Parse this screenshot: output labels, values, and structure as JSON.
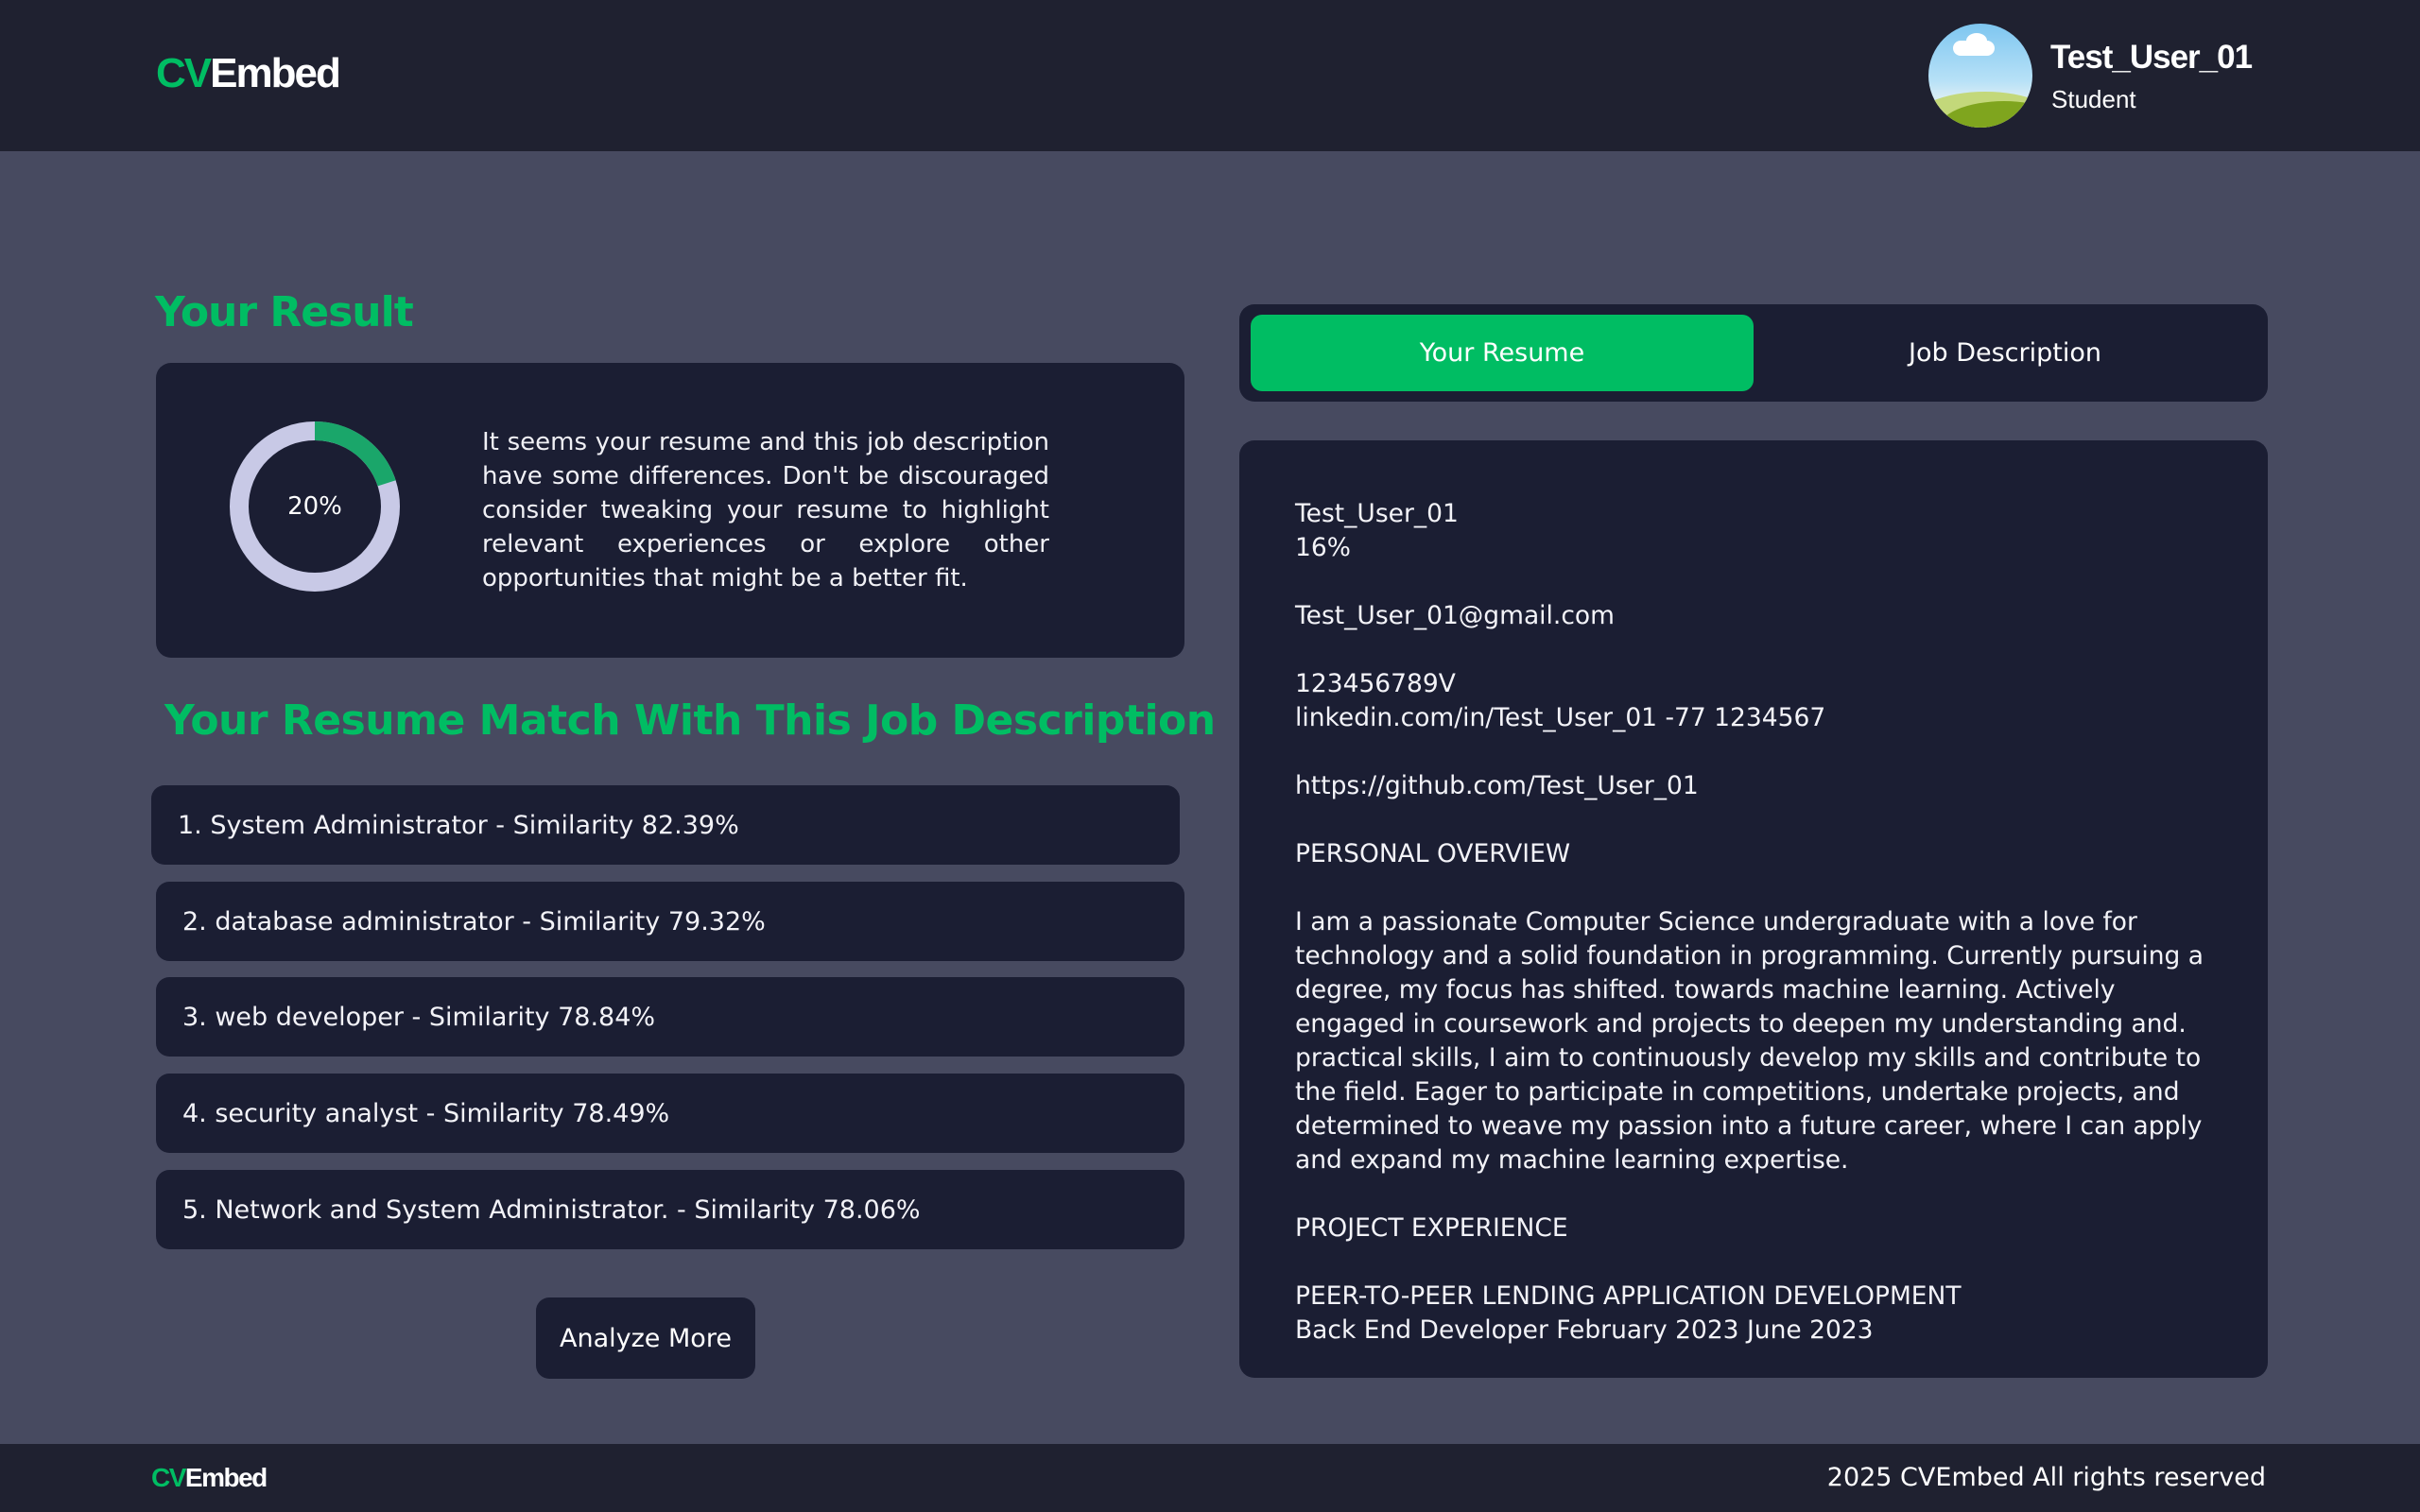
{
  "header": {
    "logo_cv": "CV",
    "logo_embed": "Embed",
    "user": {
      "name": "Test_User_01",
      "role": "Student"
    }
  },
  "result": {
    "title": "Your Result",
    "score_label": "20%",
    "score_fraction": 0.2,
    "message": "It seems your resume and this job description have some differences. Don't be discouraged consider tweaking your resume to highlight relevant experiences or explore other opportunities that might be a better fit."
  },
  "matches": {
    "title": "Your Resume Match With This Job Description",
    "items": [
      {
        "label": "1. System Administrator - Similarity 82.39%"
      },
      {
        "label": "2. database administrator - Similarity 79.32%"
      },
      {
        "label": "3. web developer - Similarity 78.84%"
      },
      {
        "label": "4. security analyst - Similarity 78.49%"
      },
      {
        "label": "5. Network and System Administrator. - Similarity 78.06%"
      }
    ],
    "analyze_button": "Analyze More"
  },
  "tabs": {
    "resume": "Your Resume",
    "job_description": "Job Description"
  },
  "resume": {
    "lines": [
      "Test_User_01",
      "16%",
      "",
      "Test_User_01@gmail.com",
      "",
      "123456789V",
      "linkedin.com/in/Test_User_01 -77 1234567",
      "",
      "https://github.com/Test_User_01",
      "",
      "PERSONAL OVERVIEW",
      ""
    ],
    "overview": "I am a passionate Computer Science undergraduate with a love for technology and a solid foundation in programming. Currently pursuing a degree, my focus has shifted. towards machine learning. Actively engaged in coursework and projects to deepen my understanding and. practical skills, I aim to continuously develop my skills and contribute to the field. Eager to participate in competitions, undertake projects, and determined to weave my passion into a future career, where I can apply and expand my machine learning expertise.",
    "lines_after": [
      "",
      "PROJECT EXPERIENCE",
      "",
      "PEER-TO-PEER LENDING APPLICATION DEVELOPMENT",
      "Back End Developer February 2023 June 2023"
    ]
  },
  "footer": {
    "logo_cv": "CV",
    "logo_embed": "Embed",
    "copyright": "2025 CVEmbed All rights reserved"
  },
  "colors": {
    "accent": "#00bd63",
    "page_bg": "#474a60",
    "card_bg": "#1b1e33",
    "bar_bg": "#1f2130",
    "donut_track": "#c8c9e6",
    "donut_fill": "#1aa66a"
  }
}
